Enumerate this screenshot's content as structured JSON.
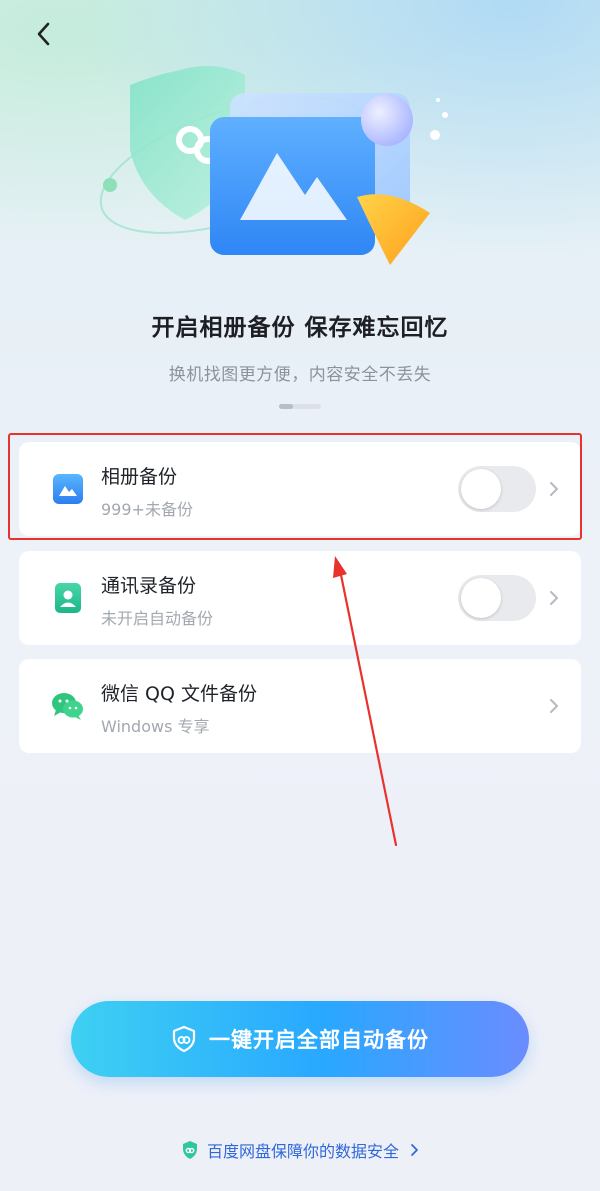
{
  "header": {
    "back_icon": "chevron-left-icon"
  },
  "hero": {
    "title": "开启相册备份 保存难忘回忆",
    "subtitle": "换机找图更方便，内容安全不丢失"
  },
  "backup_items": [
    {
      "icon": "photo-album-icon",
      "label": "相册备份",
      "desc": "999+未备份",
      "toggle": false,
      "highlighted": true
    },
    {
      "icon": "contacts-icon",
      "label": "通讯录备份",
      "desc": "未开启自动备份",
      "toggle": false
    },
    {
      "icon": "wechat-icon",
      "label": "微信 QQ 文件备份",
      "desc": "Windows 专享"
    }
  ],
  "cta": {
    "label": "一键开启全部自动备份",
    "icon": "shield-icon"
  },
  "footer": {
    "label": "百度网盘保障你的数据安全",
    "icon": "shield-icon"
  },
  "colors": {
    "accent": "#29a8ff",
    "annotation_red": "#e8322d",
    "footer_link": "#2f68d8"
  }
}
